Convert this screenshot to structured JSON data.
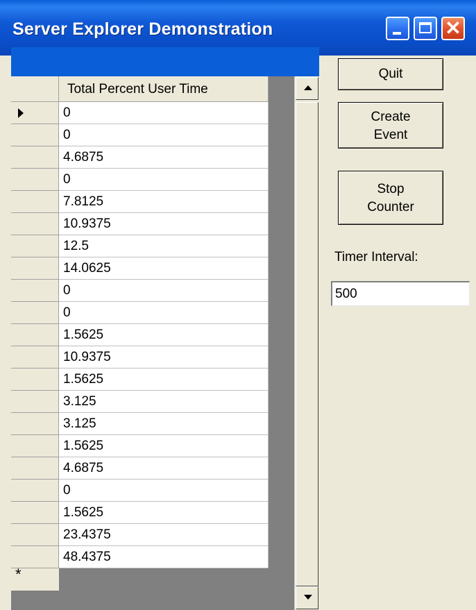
{
  "window": {
    "title": "Server Explorer Demonstration"
  },
  "grid": {
    "column_header": "Total Percent User Time",
    "current_row_index": 0,
    "rows": [
      "0",
      "0",
      "4.6875",
      "0",
      "7.8125",
      "10.9375",
      "12.5",
      "14.0625",
      "0",
      "0",
      "1.5625",
      "10.9375",
      "1.5625",
      "3.125",
      "3.125",
      "1.5625",
      "4.6875",
      "0",
      "1.5625",
      "23.4375",
      "48.4375"
    ],
    "new_row_marker": "*"
  },
  "buttons": {
    "quit": "Quit",
    "create_event": [
      "Create",
      "Event"
    ],
    "stop_counter": [
      "Stop",
      "Counter"
    ]
  },
  "timer": {
    "label": "Timer Interval:",
    "value": "500"
  },
  "colors": {
    "titlebar": "#0a5fd8",
    "caption_bar": "#0a5fd8",
    "face": "#ece9d8"
  },
  "icons": {
    "minimize": "minimize-icon",
    "maximize": "maximize-icon",
    "close": "close-icon",
    "current_row": "row-pointer-icon",
    "scroll_up": "scroll-up-arrow-icon",
    "scroll_down": "scroll-down-arrow-icon"
  }
}
